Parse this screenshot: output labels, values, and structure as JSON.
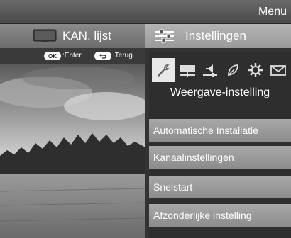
{
  "header": {
    "menu_title": "Menu"
  },
  "tabs": [
    {
      "label": "KAN. lijst",
      "icon": "tv-icon"
    },
    {
      "label": "Instellingen",
      "icon": "sliders-icon"
    }
  ],
  "hints": [
    {
      "key": "OK",
      "label": ":Enter"
    },
    {
      "key": "back",
      "label": ":Terug"
    }
  ],
  "settings": {
    "category_icons": [
      "wrench-icon",
      "display-icon",
      "speaker-icon",
      "leaf-icon",
      "gear-icon",
      "mail-icon"
    ],
    "category_title": "Weergave-instelling",
    "items": [
      "Automatische Installatie",
      "Kanaalinstellingen",
      "Snelstart",
      "Afzonderlijke instelling"
    ]
  },
  "colors": {
    "tab_active": "#a8a8a8",
    "menu_item": "#9a9a9a",
    "panel_bg": "#2e2e2e"
  }
}
